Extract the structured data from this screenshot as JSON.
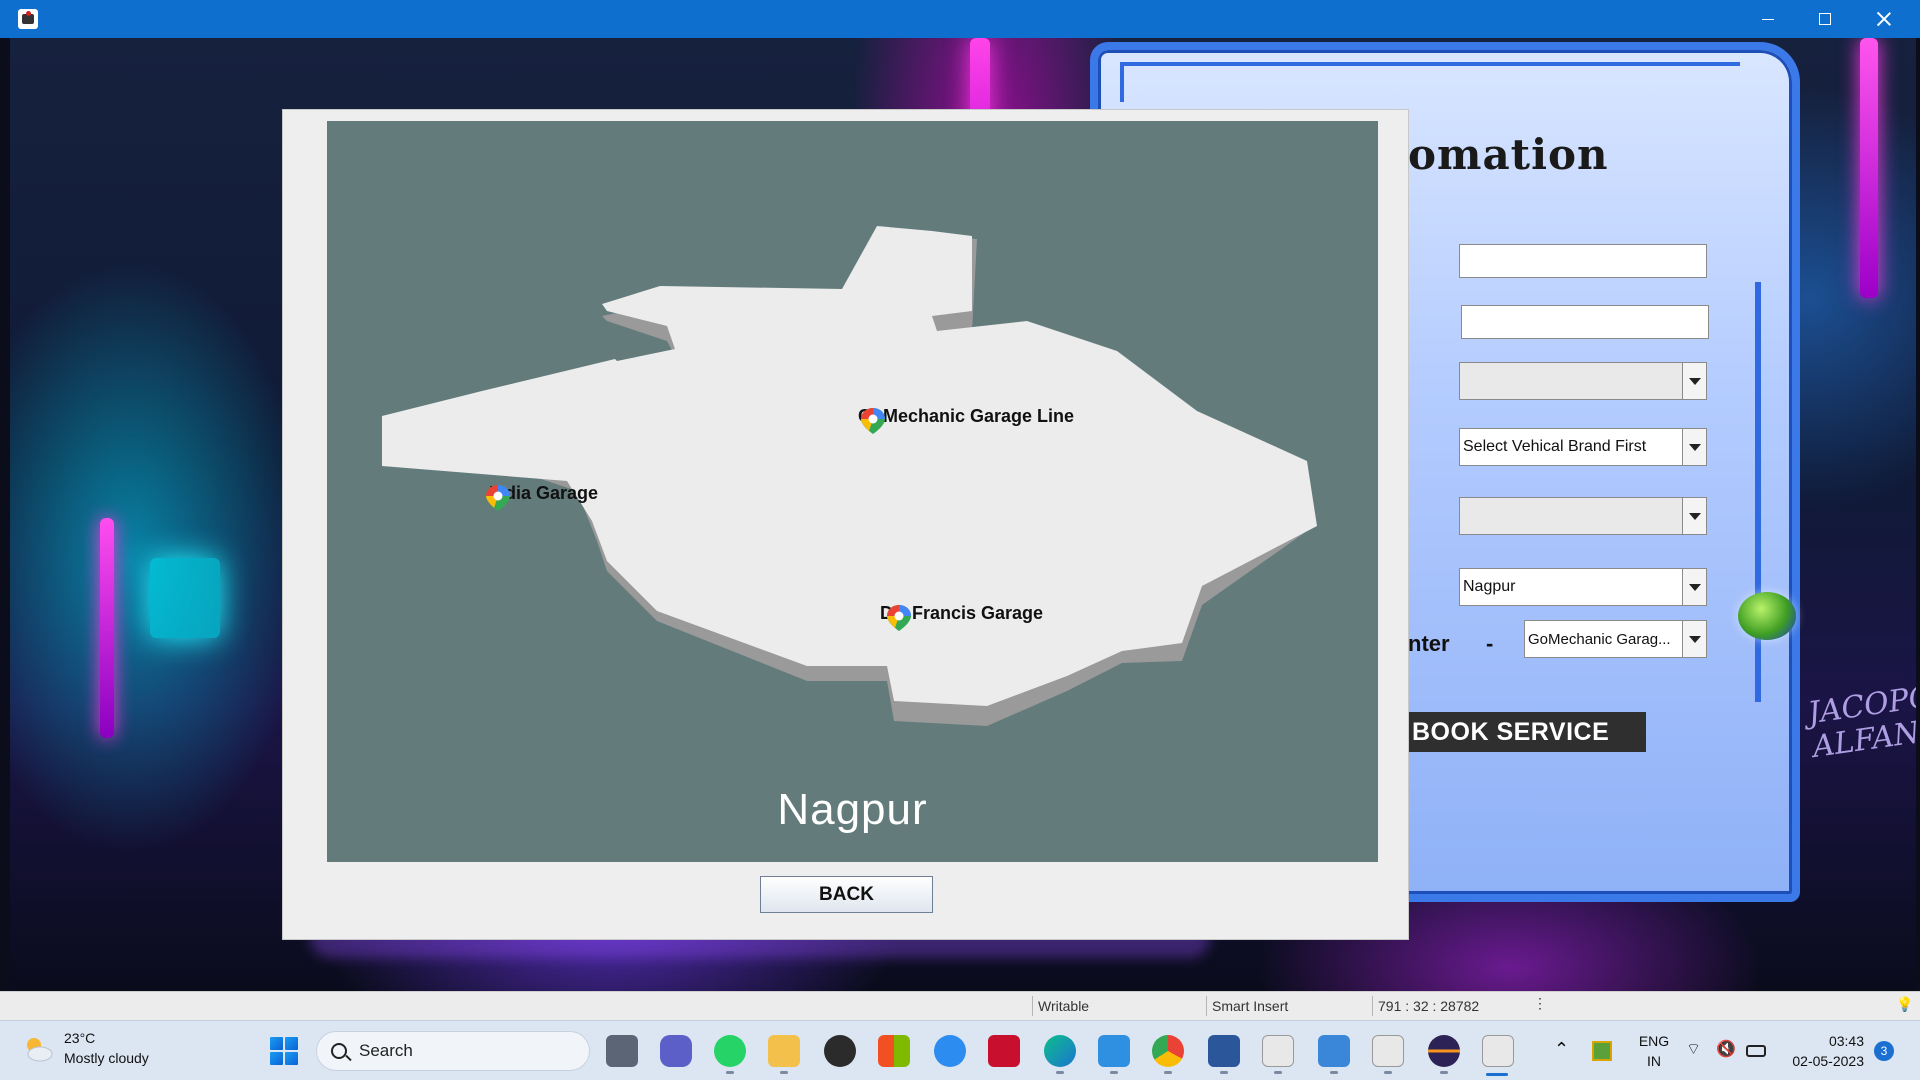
{
  "window": {
    "title": "",
    "controls": {
      "minimize": "minimize",
      "maximize": "maximize",
      "close": "close"
    }
  },
  "wallpaper": {
    "signature": "JACOPO\nALFANO"
  },
  "back_form": {
    "heading_fragment": "omation",
    "fields": [
      {
        "value": ""
      },
      {
        "value": ""
      }
    ],
    "combos": [
      {
        "value": ""
      },
      {
        "value": "Select Vehical Brand First"
      },
      {
        "value": ""
      },
      {
        "value": "Nagpur"
      },
      {
        "value": "GoMechanic Garag..."
      }
    ],
    "center_label_fragment": "nter",
    "dash": "-",
    "book_button": "BOOK SERVICE"
  },
  "map_dialog": {
    "city": "Nagpur",
    "markers": [
      {
        "label": "GoMechanic Garage Line"
      },
      {
        "label": "India Garage"
      },
      {
        "label": "DG Francis Garage"
      }
    ],
    "back_button": "BACK"
  },
  "statusbar": {
    "mode": "Writable",
    "insert": "Smart Insert",
    "position": "791 : 32 : 28782"
  },
  "taskbar": {
    "weather": {
      "temp": "23°C",
      "desc": "Mostly cloudy"
    },
    "search_label": "Search",
    "apps": [
      "task-view",
      "teams",
      "whatsapp",
      "file-explorer",
      "copilot",
      "store",
      "help",
      "mcafee",
      "edge",
      "photos",
      "chrome",
      "word",
      "java-app",
      "notepad",
      "java-app-2",
      "eclipse",
      "java-app-3"
    ],
    "language": "ENG",
    "region": "IN",
    "time": "03:43",
    "date": "02-05-2023",
    "notifications": "3"
  },
  "colors": {
    "titlebar": "#0f6fce",
    "map_bg": "#637b7b",
    "map_land": "#ededed",
    "book_button": "#2f2f2f",
    "taskbar": "#dce6f2"
  }
}
